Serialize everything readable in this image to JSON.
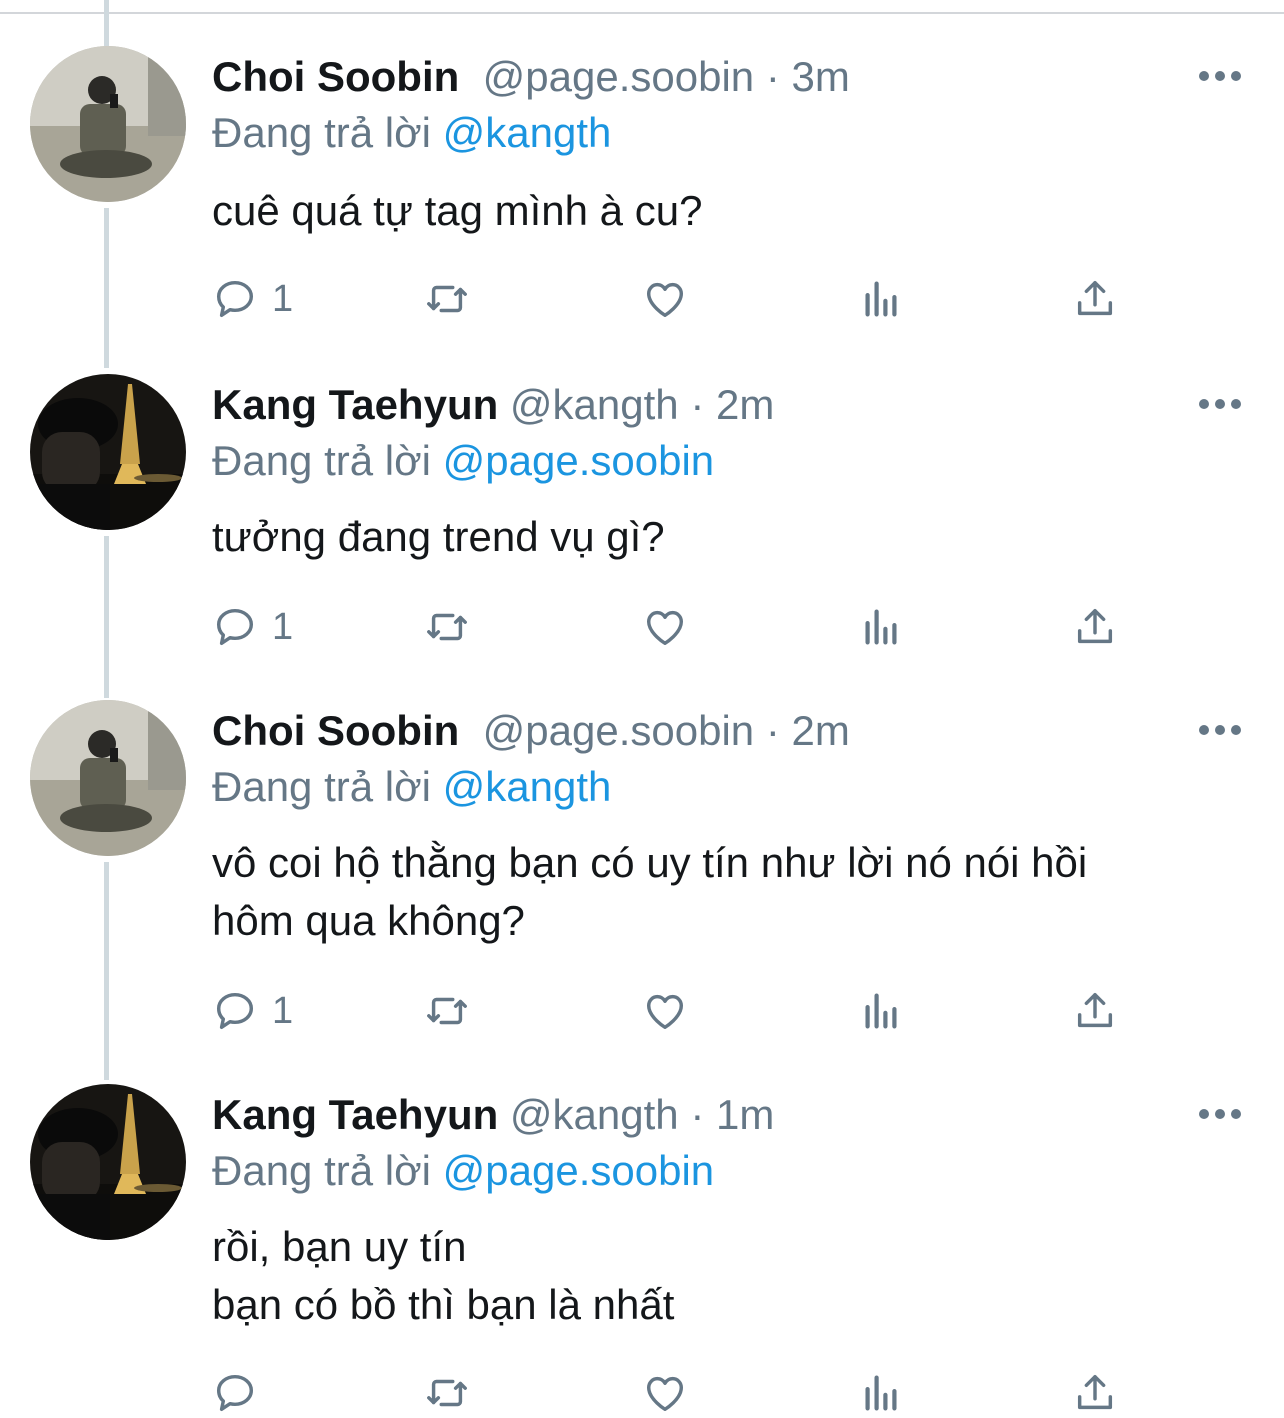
{
  "tweets": [
    {
      "name": "Choi Soobin",
      "handle": "@page.soobin",
      "dot": "·",
      "time": "3m",
      "reply_prefix": "Đang trả lời",
      "reply_mention": "@kangth",
      "text": "cuê quá tự tag mình à cu?",
      "reply_count": "1",
      "avatar": "avatar-soobin"
    },
    {
      "name": "Kang Taehyun",
      "handle": "@kangth",
      "dot": "·",
      "time": "2m",
      "reply_prefix": "Đang trả lời",
      "reply_mention": "@page.soobin",
      "text": "tưởng đang trend vụ gì?",
      "reply_count": "1",
      "avatar": "avatar-taehyun"
    },
    {
      "name": "Choi Soobin",
      "handle": "@page.soobin",
      "dot": "·",
      "time": "2m",
      "reply_prefix": "Đang trả lời",
      "reply_mention": "@kangth",
      "text": "vô coi hộ thằng bạn có uy tín như lời nó nói hồi\nhôm qua không?",
      "reply_count": "1",
      "avatar": "avatar-soobin"
    },
    {
      "name": "Kang Taehyun",
      "handle": "@kangth",
      "dot": "·",
      "time": "1m",
      "reply_prefix": "Đang trả lời",
      "reply_mention": "@page.soobin",
      "text": "rồi, bạn uy tín\nbạn có bồ thì bạn là nhất",
      "reply_count": "",
      "avatar": "avatar-taehyun"
    }
  ],
  "colors": {
    "text": "#14171a",
    "secondary": "#657786",
    "link": "#1b95e0",
    "thread_line": "#cfd9de"
  },
  "icons": [
    "reply-icon",
    "retweet-icon",
    "like-icon",
    "analytics-icon",
    "share-icon",
    "more-icon"
  ]
}
